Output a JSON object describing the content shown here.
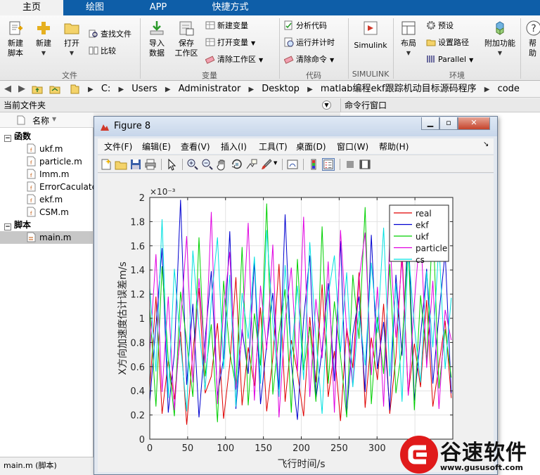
{
  "tabs": [
    {
      "label": "主页",
      "active": true
    },
    {
      "label": "绘图",
      "active": false
    },
    {
      "label": "APP",
      "active": false
    },
    {
      "label": "快捷方式",
      "active": false
    }
  ],
  "ribbon": {
    "file": {
      "group_label": "文件",
      "new_script": "新建\n脚本",
      "new": "新建",
      "open": "打开",
      "find_files": "查找文件",
      "compare": "比较"
    },
    "variable": {
      "group_label": "变量",
      "import_data": "导入\n数据",
      "save_workspace": "保存\n工作区",
      "new_variable": "新建变量",
      "open_variable": "打开变量",
      "clear_workspace": "清除工作区"
    },
    "code": {
      "group_label": "代码",
      "analyze_code": "分析代码",
      "run_and_time": "运行并计时",
      "clear_commands": "清除命令"
    },
    "simulink": {
      "group_label": "SIMULINK",
      "simulink": "Simulink"
    },
    "environment": {
      "group_label": "环境",
      "layout": "布局",
      "preferences": "预设",
      "set_path": "设置路径",
      "parallel": "Parallel",
      "addons": "附加功能",
      "help": "帮助"
    }
  },
  "address": {
    "crumbs": [
      "C:",
      "Users",
      "Administrator",
      "Desktop",
      "matlab编程ekf跟踪机动目标源码程序",
      "code"
    ]
  },
  "file_panel": {
    "title": "当前文件夹",
    "column_name": "名称",
    "groups": [
      {
        "label": "函数",
        "files": [
          "ukf.m",
          "particle.m",
          "Imm.m",
          "ErrorCaculate.m",
          "ekf.m",
          "CSM.m"
        ]
      },
      {
        "label": "脚本",
        "files": [
          "main.m"
        ]
      }
    ],
    "selected_file": "main.m",
    "details": "main.m  (脚本)"
  },
  "command_window": {
    "title": "命令行窗口"
  },
  "figure": {
    "title": "Figure 8",
    "menus": [
      "文件(F)",
      "编辑(E)",
      "查看(V)",
      "插入(I)",
      "工具(T)",
      "桌面(D)",
      "窗口(W)",
      "帮助(H)"
    ]
  },
  "chart_data": {
    "type": "line",
    "title": "",
    "xlabel": "飞行时间/s",
    "ylabel": "X方向加速度估计误差m/s",
    "y_exponent_label": "×10⁻³",
    "xlim": [
      0,
      400
    ],
    "ylim": [
      0,
      0.002
    ],
    "x_ticks": [
      0,
      50,
      100,
      150,
      200,
      250,
      300,
      350
    ],
    "y_ticks": [
      0,
      0.0002,
      0.0004,
      0.0006,
      0.0008,
      0.001,
      0.0012,
      0.0014,
      0.0016,
      0.0018,
      0.002
    ],
    "y_tick_labels": [
      "0",
      "0.2",
      "0.4",
      "0.6",
      "0.8",
      "1",
      "1.2",
      "1.4",
      "1.6",
      "1.8",
      "2"
    ],
    "grid": true,
    "legend_position": "top-right",
    "series": [
      {
        "name": "real",
        "color": "#e00000",
        "values": [
          0.00042,
          0.00118,
          0.00021,
          0.00065,
          0.00033,
          0.00089,
          0.00012,
          0.00071,
          0.00125,
          0.00038,
          0.00052,
          0.00096,
          0.00017,
          0.00062,
          0.00134,
          0.00028,
          0.00076,
          0.00044,
          0.00109,
          0.00023,
          0.00067,
          0.00145,
          0.00031,
          0.00082,
          0.00055,
          0.00019,
          0.00101,
          0.00047,
          0.00128,
          0.00035,
          0.00073,
          0.00015,
          0.00092,
          0.00059,
          0.00138,
          0.00026,
          0.00084,
          0.00049,
          0.00112,
          0.00021,
          0.00068,
          0.00156,
          0.00037,
          0.00079,
          0.00043,
          0.00115,
          0.00027,
          0.00061,
          0.00098,
          0.00034
        ]
      },
      {
        "name": "ekf",
        "color": "#0000d0",
        "values": [
          0.00031,
          0.00094,
          0.00158,
          0.00022,
          0.00071,
          0.00198,
          0.00045,
          0.00112,
          0.00018,
          0.00083,
          0.00139,
          0.00036,
          0.00067,
          0.00172,
          0.00025,
          0.00091,
          0.00054,
          0.00147,
          0.00029,
          0.00078,
          0.00121,
          0.00041,
          0.00186,
          0.00063,
          0.00016,
          0.00099,
          0.00152,
          0.00033,
          0.00074,
          0.00129,
          0.00048,
          0.00164,
          0.00021,
          0.00087,
          0.00118,
          0.00039,
          0.00169,
          0.00058,
          0.00097,
          0.00024,
          0.00136,
          0.00069,
          0.00178,
          0.00032,
          0.00085,
          0.00141,
          0.00046,
          0.00103,
          0.00155,
          0.00038
        ]
      },
      {
        "name": "ukf",
        "color": "#00d000",
        "values": [
          0.00108,
          0.00027,
          0.00143,
          0.00066,
          0.00019,
          0.00122,
          0.00081,
          0.00035,
          0.00167,
          0.00052,
          0.00095,
          0.00014,
          0.00131,
          0.00072,
          0.00043,
          0.00159,
          0.00028,
          0.00104,
          0.00061,
          0.00195,
          0.00037,
          0.00088,
          0.00124,
          0.00022,
          0.00149,
          0.00057,
          0.00093,
          0.00031,
          0.00176,
          0.00046,
          0.00114,
          0.00069,
          0.00018,
          0.00136,
          0.00083,
          0.00192,
          0.00029,
          0.00101,
          0.00054,
          0.00145,
          0.00038,
          0.00077,
          0.00161,
          0.00024,
          0.00119,
          0.00065,
          0.00183,
          0.00042,
          0.00091,
          0.00051
        ]
      },
      {
        "name": "particle",
        "color": "#e000e0",
        "values": [
          0.00072,
          0.00153,
          0.00039,
          0.00118,
          0.00024,
          0.00096,
          0.00168,
          0.00047,
          0.00133,
          0.00063,
          0.00188,
          0.00029,
          0.00107,
          0.00155,
          0.00041,
          0.00086,
          0.00179,
          0.00032,
          0.00127,
          0.00074,
          0.00161,
          0.00018,
          0.00098,
          0.00142,
          0.00056,
          0.00184,
          0.00035,
          0.00116,
          0.00067,
          0.00147,
          0.00022,
          0.00173,
          0.00089,
          0.00044,
          0.00132,
          0.00171,
          0.00053,
          0.00126,
          0.00027,
          0.00165,
          0.00084,
          0.00149,
          0.00036,
          0.00113,
          0.00176,
          0.00059,
          0.00131,
          0.00025,
          0.00107,
          0.00082
        ]
      },
      {
        "name": "cs",
        "color": "#00e0e0",
        "values": [
          0.00125,
          0.00056,
          0.00182,
          0.00034,
          0.00141,
          0.00079,
          0.00023,
          0.00156,
          0.00092,
          0.00041,
          0.00114,
          0.00167,
          0.00058,
          0.00136,
          0.00027,
          0.00121,
          0.00083,
          0.00151,
          0.00046,
          0.00173,
          0.00097,
          0.00035,
          0.00144,
          0.00068,
          0.00127,
          0.00049,
          0.00163,
          0.00084,
          0.00021,
          0.00119,
          0.00152,
          0.00072,
          0.00138,
          0.00043,
          0.00106,
          0.00061,
          0.00146,
          0.00088,
          0.00175,
          0.00052,
          0.00129,
          0.00031,
          0.00158,
          0.00094,
          0.00047,
          0.00139,
          0.00076,
          0.00162,
          0.00058,
          0.00117
        ]
      }
    ]
  },
  "logo": {
    "text": "谷速软件",
    "url": "www.gususoft.com",
    "color": "#e01a1a"
  }
}
